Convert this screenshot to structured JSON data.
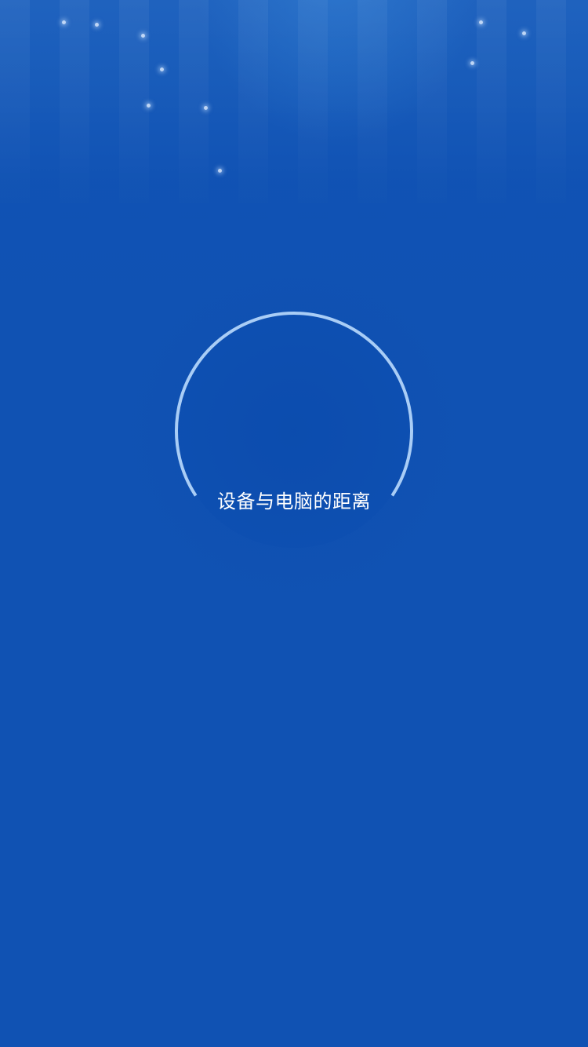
{
  "screen": {
    "background_color": "#1052b3",
    "accent_color": "#a9cdf6"
  },
  "gauge": {
    "label": "设备与电脑的距离"
  }
}
